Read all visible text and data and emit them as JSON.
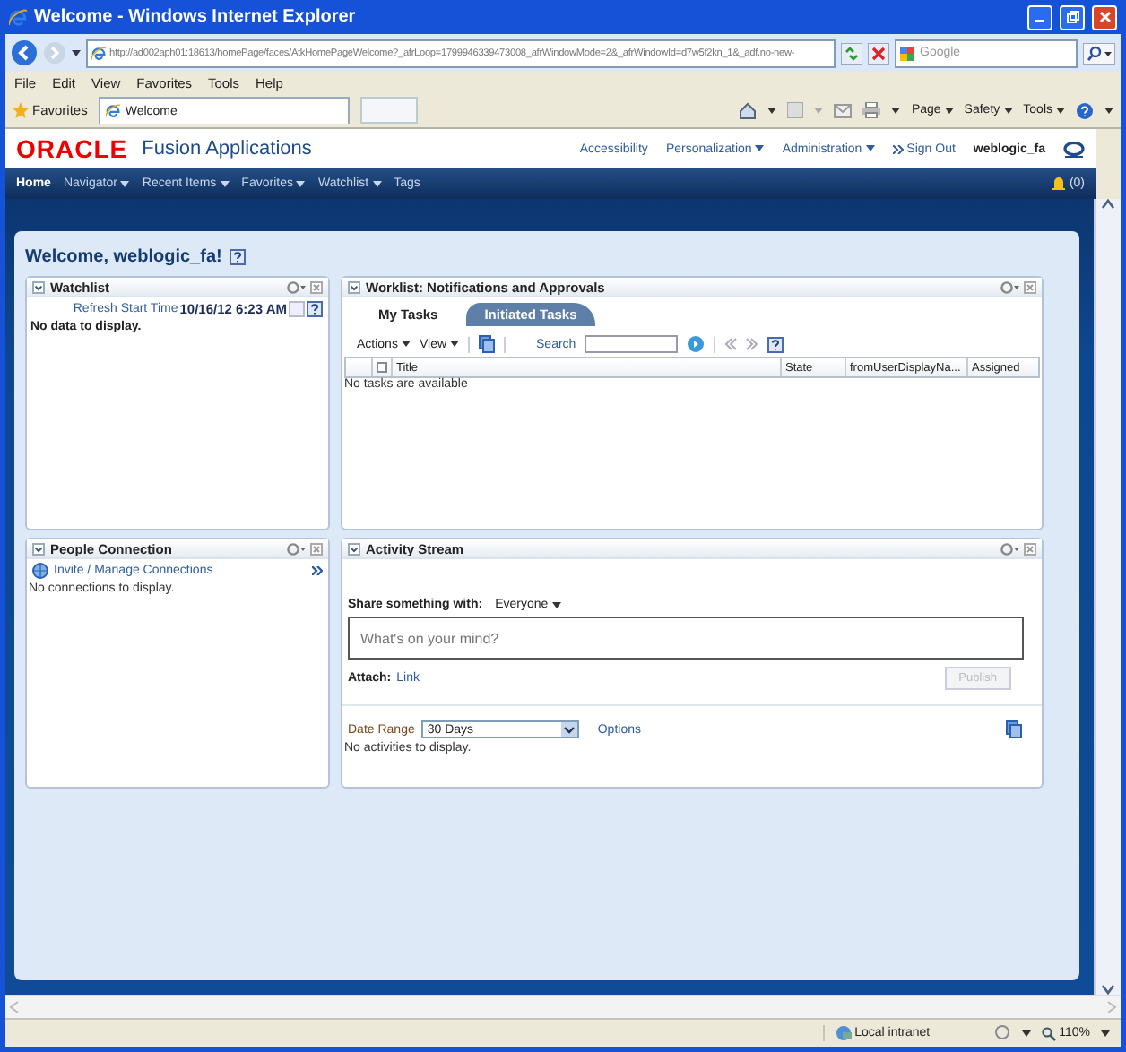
{
  "browser": {
    "title": "Welcome - Windows Internet Explorer",
    "address": "http://ad002aph01:18613/homePage/faces/AtkHomePageWelcome?_afrLoop=1799946339473008_afrWindowMode=2&_afrWindowId=d7w5f2kn_1&_adf.no-new-",
    "search_placeholder": "Google",
    "menu": [
      "File",
      "Edit",
      "View",
      "Favorites",
      "Tools",
      "Help"
    ],
    "favorites": "Favorites",
    "tab": "Welcome",
    "commands": [
      "Page",
      "Safety",
      "Tools"
    ]
  },
  "app": {
    "brand": "ORACLE",
    "product": "Fusion Applications",
    "links": [
      {
        "label": "Accessibility",
        "dropdown": false
      },
      {
        "label": "Personalization",
        "dropdown": true
      },
      {
        "label": "Administration",
        "dropdown": true
      }
    ],
    "sign_out": "Sign Out",
    "user": "weblogic_fa",
    "nav": [
      {
        "label": "Home",
        "selected": true,
        "dropdown": false
      },
      {
        "label": "Navigator",
        "selected": false,
        "dropdown": true
      },
      {
        "label": "Recent Items",
        "selected": false,
        "dropdown": true
      },
      {
        "label": "Favorites",
        "selected": false,
        "dropdown": true
      },
      {
        "label": "Watchlist",
        "selected": false,
        "dropdown": true
      },
      {
        "label": "Tags",
        "selected": false,
        "dropdown": false
      }
    ],
    "notifications": "(0)"
  },
  "page": {
    "welcome": "Welcome, weblogic_fa!"
  },
  "watchlist": {
    "title": "Watchlist",
    "refresh_label": "Refresh Start Time",
    "refresh_time": "10/16/12 6:23 AM",
    "empty": "No data to display."
  },
  "worklist": {
    "title": "Worklist: Notifications and Approvals",
    "tabs": [
      {
        "label": "My Tasks",
        "selected": false
      },
      {
        "label": "Initiated Tasks",
        "selected": true
      }
    ],
    "actions": "Actions",
    "view": "View",
    "search_label": "Search",
    "columns": [
      "Title",
      "State",
      "fromUserDisplayNa...",
      "Assigned"
    ],
    "empty": "No tasks are available"
  },
  "people": {
    "title": "People Connection",
    "link": "Invite / Manage Connections",
    "empty": "No connections to display."
  },
  "activity": {
    "title": "Activity Stream",
    "share_label": "Share something with:",
    "share_with": "Everyone",
    "placeholder": "What's on your mind?",
    "attach_label": "Attach:",
    "attach_link": "Link",
    "publish": "Publish",
    "publish_disabled": true,
    "date_range_label": "Date Range",
    "date_range": "30 Days",
    "options": "Options",
    "empty": "No activities to display."
  },
  "status": {
    "zone": "Local intranet",
    "zoom": "110%"
  }
}
